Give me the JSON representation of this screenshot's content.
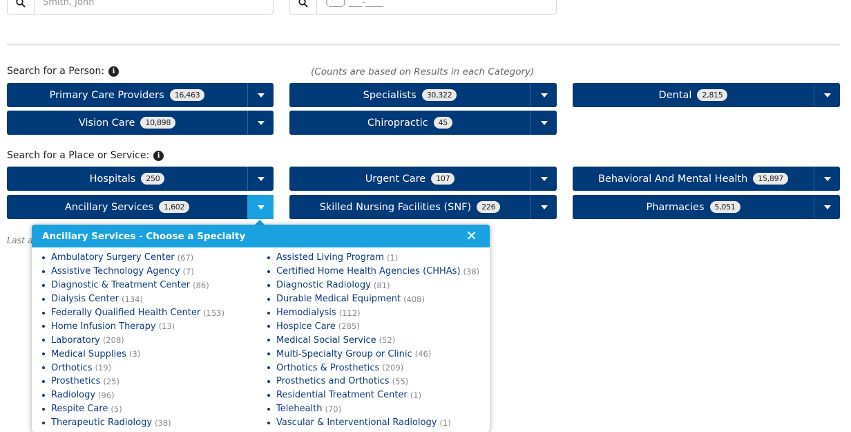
{
  "search": {
    "name_placeholder": "Smith, John",
    "phone_placeholder": "(___) ___-____"
  },
  "person_section": {
    "label": "Search for a Person:",
    "counts_note": "(Counts are based on Results in each Category)"
  },
  "person_categories": [
    {
      "label": "Primary Care Providers",
      "count": "16,463"
    },
    {
      "label": "Specialists",
      "count": "30,322"
    },
    {
      "label": "Dental",
      "count": "2,815"
    },
    {
      "label": "Vision Care",
      "count": "10,898"
    },
    {
      "label": "Chiropractic",
      "count": "45"
    }
  ],
  "place_section": {
    "label": "Search for a Place or Service:"
  },
  "place_categories": [
    {
      "label": "Hospitals",
      "count": "250"
    },
    {
      "label": "Urgent Care",
      "count": "107"
    },
    {
      "label": "Behavioral And Mental Health",
      "count": "15,897"
    },
    {
      "label": "Ancillary Services",
      "count": "1,602"
    },
    {
      "label": "Skilled Nursing Facilities (SNF)",
      "count": "226"
    },
    {
      "label": "Pharmacies",
      "count": "5,051"
    }
  ],
  "last_text": "Last a",
  "popup": {
    "title": "Ancillary Services - Choose a Specialty",
    "close_glyph": "✕",
    "left_column": [
      {
        "name": "Ambulatory Surgery Center",
        "count": "(67)"
      },
      {
        "name": "Assistive Technology Agency",
        "count": "(7)"
      },
      {
        "name": "Diagnostic & Treatment Center",
        "count": "(86)"
      },
      {
        "name": "Dialysis Center",
        "count": "(134)"
      },
      {
        "name": "Federally Qualified Health Center",
        "count": "(153)"
      },
      {
        "name": "Home Infusion Therapy",
        "count": "(13)"
      },
      {
        "name": "Laboratory",
        "count": "(208)"
      },
      {
        "name": "Medical Supplies",
        "count": "(3)"
      },
      {
        "name": "Orthotics",
        "count": "(19)"
      },
      {
        "name": "Prosthetics",
        "count": "(25)"
      },
      {
        "name": "Radiology",
        "count": "(96)"
      },
      {
        "name": "Respite Care",
        "count": "(5)"
      },
      {
        "name": "Therapeutic Radiology",
        "count": "(38)"
      }
    ],
    "right_column": [
      {
        "name": "Assisted Living Program",
        "count": "(1)"
      },
      {
        "name": "Certified Home Health Agencies (CHHAs)",
        "count": "(38)"
      },
      {
        "name": "Diagnostic Radiology",
        "count": "(81)"
      },
      {
        "name": "Durable Medical Equipment",
        "count": "(408)"
      },
      {
        "name": "Hemodialysis",
        "count": "(112)"
      },
      {
        "name": "Hospice Care",
        "count": "(285)"
      },
      {
        "name": "Medical Social Service",
        "count": "(52)"
      },
      {
        "name": "Multi-Specialty Group or Clinic",
        "count": "(46)"
      },
      {
        "name": "Orthotics & Prosthetics",
        "count": "(209)"
      },
      {
        "name": "Prosthetics and Orthotics",
        "count": "(55)"
      },
      {
        "name": "Residential Treatment Center",
        "count": "(1)"
      },
      {
        "name": "Telehealth",
        "count": "(70)"
      },
      {
        "name": "Vascular & Interventional Radiology",
        "count": "(1)"
      }
    ]
  },
  "colors": {
    "primary": "#003a78",
    "accent": "#1aa2e0",
    "link": "#0b3a7a"
  },
  "icons": {
    "search": "magnifier-icon",
    "info": "info-icon",
    "dropdown": "caret-down-icon",
    "close": "close-icon"
  }
}
